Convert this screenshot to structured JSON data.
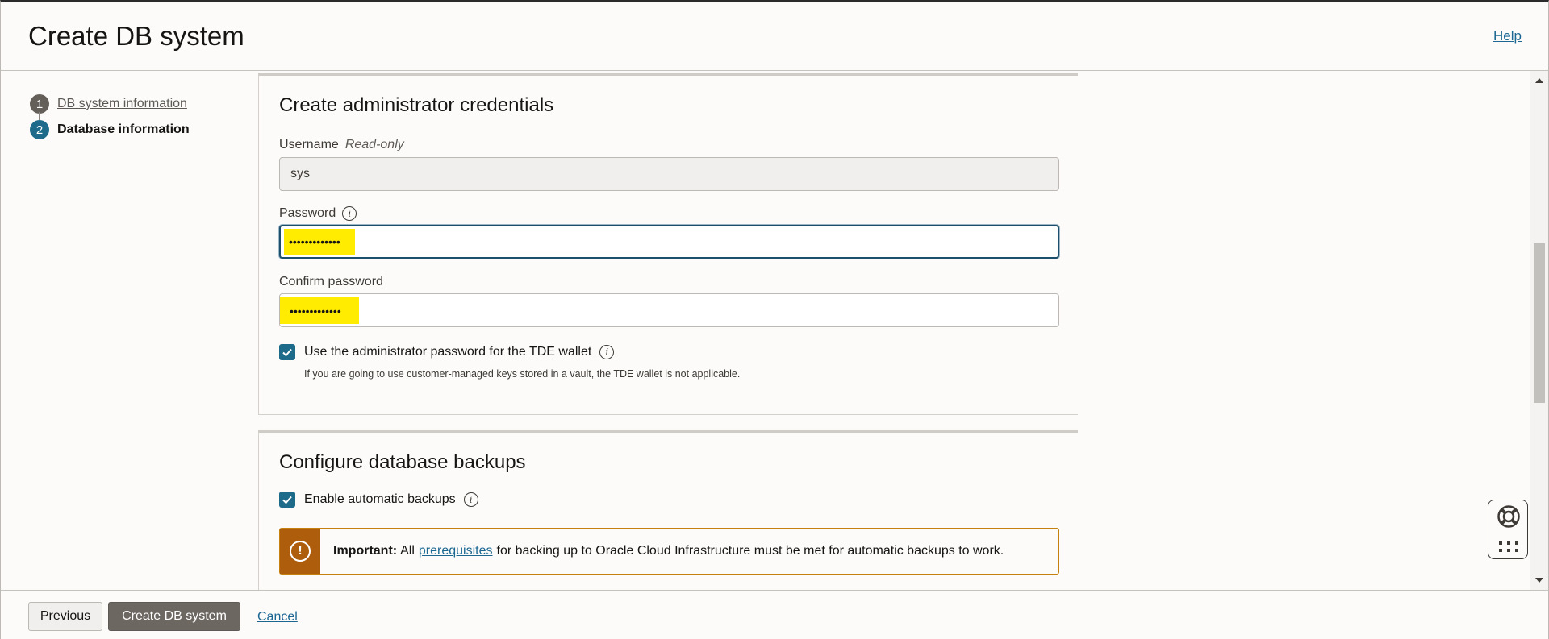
{
  "header": {
    "title": "Create DB system",
    "help_label": "Help"
  },
  "steps": [
    {
      "number": "1",
      "label": "DB system information",
      "state": "completed"
    },
    {
      "number": "2",
      "label": "Database information",
      "state": "current"
    }
  ],
  "credentials_section": {
    "title": "Create administrator credentials",
    "username": {
      "label": "Username",
      "readonly_note": "Read-only",
      "value": "sys"
    },
    "password": {
      "label": "Password",
      "masked_value": "•••••••••••••"
    },
    "confirm_password": {
      "label": "Confirm password",
      "masked_value": "•••••••••••••"
    },
    "tde_checkbox": {
      "label": "Use the administrator password for the TDE wallet",
      "checked": true,
      "hint": "If you are going to use customer-managed keys stored in a vault, the TDE wallet is not applicable."
    }
  },
  "backups_section": {
    "title": "Configure database backups",
    "enable_backups": {
      "label": "Enable automatic backups",
      "checked": true
    },
    "important_banner": {
      "prefix": "Important:",
      "text_before_link": "All",
      "link_text": "prerequisites",
      "text_after_link": "for backing up to Oracle Cloud Infrastructure must be met for automatic backups to work."
    }
  },
  "footer": {
    "previous_label": "Previous",
    "create_label": "Create DB system",
    "cancel_label": "Cancel"
  },
  "colors": {
    "accent": "#1d6a8a",
    "highlight": "#ffec00",
    "warning": "#ad5d0c",
    "link": "#1b6792"
  }
}
